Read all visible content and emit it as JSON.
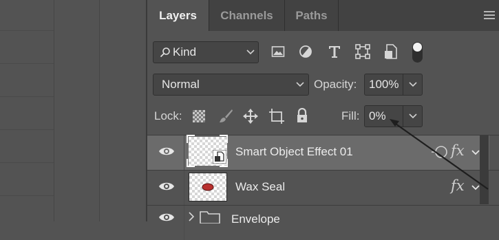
{
  "panel": {
    "tabs": [
      {
        "label": "Layers"
      },
      {
        "label": "Channels"
      },
      {
        "label": "Paths"
      }
    ]
  },
  "filter": {
    "kind_label": "Kind",
    "icons": [
      "image-filter-icon",
      "adjustment-filter-icon",
      "type-filter-icon",
      "shape-filter-icon",
      "smart-object-filter-icon",
      "filter-toggle-icon"
    ]
  },
  "blend": {
    "mode": "Normal",
    "opacity_label": "Opacity:",
    "opacity_value": "100%"
  },
  "lock": {
    "label": "Lock:",
    "fill_label": "Fill:",
    "fill_value": "0%"
  },
  "layers": [
    {
      "name": "Smart Object Effect 01",
      "selected": true,
      "has_fx": true,
      "is_smart_object": true
    },
    {
      "name": "Wax Seal",
      "selected": false,
      "has_fx": true
    },
    {
      "name": "Envelope",
      "selected": false,
      "is_group": true
    }
  ],
  "colors": {
    "panel_bg": "#535353",
    "selected_row": "#6b6b6b",
    "wax_seal_red": "#b8302e"
  }
}
